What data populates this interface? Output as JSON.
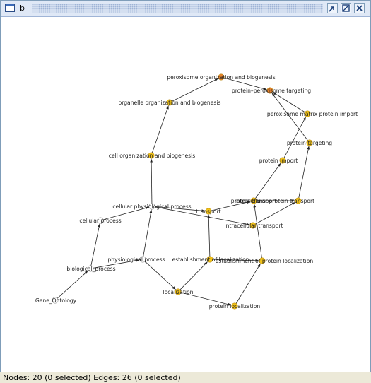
{
  "window": {
    "title": "b"
  },
  "status": {
    "text": "Nodes: 20 (0 selected) Edges: 26 (0 selected)"
  },
  "colors": {
    "node_yellow": "#f2c318",
    "node_orange": "#e8822a",
    "node_white": "#ffffff",
    "edge": "#222222"
  },
  "graph": {
    "nodes": [
      {
        "id": "peroxisome-org",
        "label": "peroxisome organization and biogenesis",
        "color": "orange"
      },
      {
        "id": "protein-perox",
        "label": "protein–peroxisome targeting",
        "color": "orange"
      },
      {
        "id": "organelle-org",
        "label": "organelle organization and biogenesis",
        "color": "yellow"
      },
      {
        "id": "matrix-import",
        "label": "peroxisome matrix protein import",
        "color": "yellow"
      },
      {
        "id": "protein-targeting",
        "label": "protein targeting",
        "color": "yellow"
      },
      {
        "id": "cell-org",
        "label": "cell organization and biogenesis",
        "color": "yellow"
      },
      {
        "id": "protein-import",
        "label": "protein import",
        "color": "yellow"
      },
      {
        "id": "protein-transport",
        "label": "protein transport",
        "color": "yellow"
      },
      {
        "id": "intracellular-protein-transport",
        "label": "intracellular protein transport",
        "color": "yellow"
      },
      {
        "id": "cellular-physiological",
        "label": "cellular physiological process",
        "color": "white"
      },
      {
        "id": "transport",
        "label": "transport",
        "color": "yellow"
      },
      {
        "id": "intracellular-transport",
        "label": "intracellular transport",
        "color": "yellow"
      },
      {
        "id": "cellular-process",
        "label": "cellular process",
        "color": "white"
      },
      {
        "id": "physiological-process",
        "label": "physiological process",
        "color": "white"
      },
      {
        "id": "establishment-of-localization",
        "label": "establishment of localization",
        "color": "yellow"
      },
      {
        "id": "establishment-protein-localization",
        "label": "establishment of protein localization",
        "color": "yellow"
      },
      {
        "id": "biological-process",
        "label": "biological_process",
        "color": "white"
      },
      {
        "id": "localization",
        "label": "localization",
        "color": "yellow"
      },
      {
        "id": "gene-ontology",
        "label": "Gene_Ontology",
        "color": "white"
      },
      {
        "id": "protein-localization",
        "label": "protein localization",
        "color": "yellow"
      }
    ],
    "edges": [
      [
        "gene-ontology",
        "biological-process"
      ],
      [
        "biological-process",
        "cellular-process"
      ],
      [
        "biological-process",
        "physiological-process"
      ],
      [
        "physiological-process",
        "cellular-physiological"
      ],
      [
        "physiological-process",
        "localization"
      ],
      [
        "cellular-process",
        "cellular-physiological"
      ],
      [
        "cellular-physiological",
        "cell-org"
      ],
      [
        "cell-org",
        "organelle-org"
      ],
      [
        "organelle-org",
        "peroxisome-org"
      ],
      [
        "peroxisome-org",
        "protein-perox"
      ],
      [
        "cellular-physiological",
        "transport"
      ],
      [
        "cellular-physiological",
        "intracellular-transport"
      ],
      [
        "localization",
        "establishment-of-localization"
      ],
      [
        "localization",
        "protein-localization"
      ],
      [
        "establishment-of-localization",
        "transport"
      ],
      [
        "establishment-of-localization",
        "establishment-protein-localization"
      ],
      [
        "protein-localization",
        "establishment-protein-localization"
      ],
      [
        "establishment-protein-localization",
        "protein-transport"
      ],
      [
        "transport",
        "protein-transport"
      ],
      [
        "intracellular-transport",
        "intracellular-protein-transport"
      ],
      [
        "protein-transport",
        "intracellular-protein-transport"
      ],
      [
        "protein-transport",
        "protein-import"
      ],
      [
        "intracellular-protein-transport",
        "protein-targeting"
      ],
      [
        "protein-import",
        "matrix-import"
      ],
      [
        "protein-targeting",
        "protein-perox"
      ],
      [
        "matrix-import",
        "protein-perox"
      ]
    ]
  }
}
